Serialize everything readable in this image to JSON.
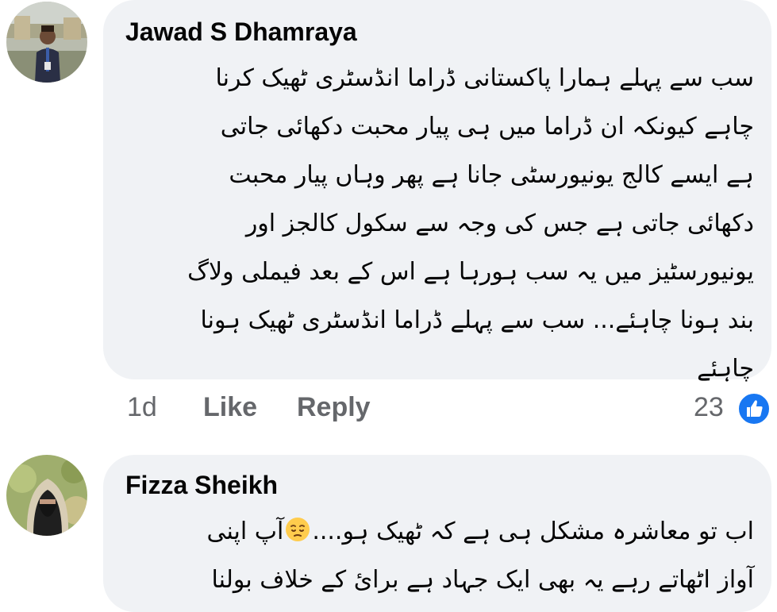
{
  "comments": [
    {
      "author": "Jawad S Dhamraya",
      "lines": [
        "سب سے پہلے ہمارا پاکستانی ڈراما انڈسٹری ٹھیک کرنا",
        "چاہے کیونکہ ان ڈراما میں ہی پیار محبت دکھائی جاتی",
        "ہے ایسے کالج یونیورسٹی جانا ہے پھر وہاں پیار محبت",
        "دکھائی جاتی ہے جس کی وجہ سے سکول کالجز اور",
        "یونیورسٹیز میں یہ سب ہورہا ہے اس کے بعد فیملی ولاگ",
        "بند ہونا چاہئے... سب سے پہلے ڈراما انڈسٹری ٹھیک ہونا",
        "چاہئے"
      ],
      "time": "1d",
      "like_label": "Like",
      "reply_label": "Reply",
      "reaction_count": "23",
      "reaction_icon": "thumbs-up-icon",
      "reaction_color": "#1877f2"
    },
    {
      "author": "Fizza Sheikh",
      "line1_before_emoji": "اب تو معاشرہ مشکل ہی ہے کہ ٹھیک ہو....",
      "line1_emoji": "pensive-face-emoji",
      "line1_after_emoji": "آپ اپنی",
      "line2": "آواز اٹھاتے رہے یہ بھی ایک جہاد ہے برائ کے خلاف بولنا"
    }
  ],
  "colors": {
    "bubble": "#f0f2f5",
    "text": "#050505",
    "secondary": "#65676b",
    "accent": "#1877f2"
  }
}
